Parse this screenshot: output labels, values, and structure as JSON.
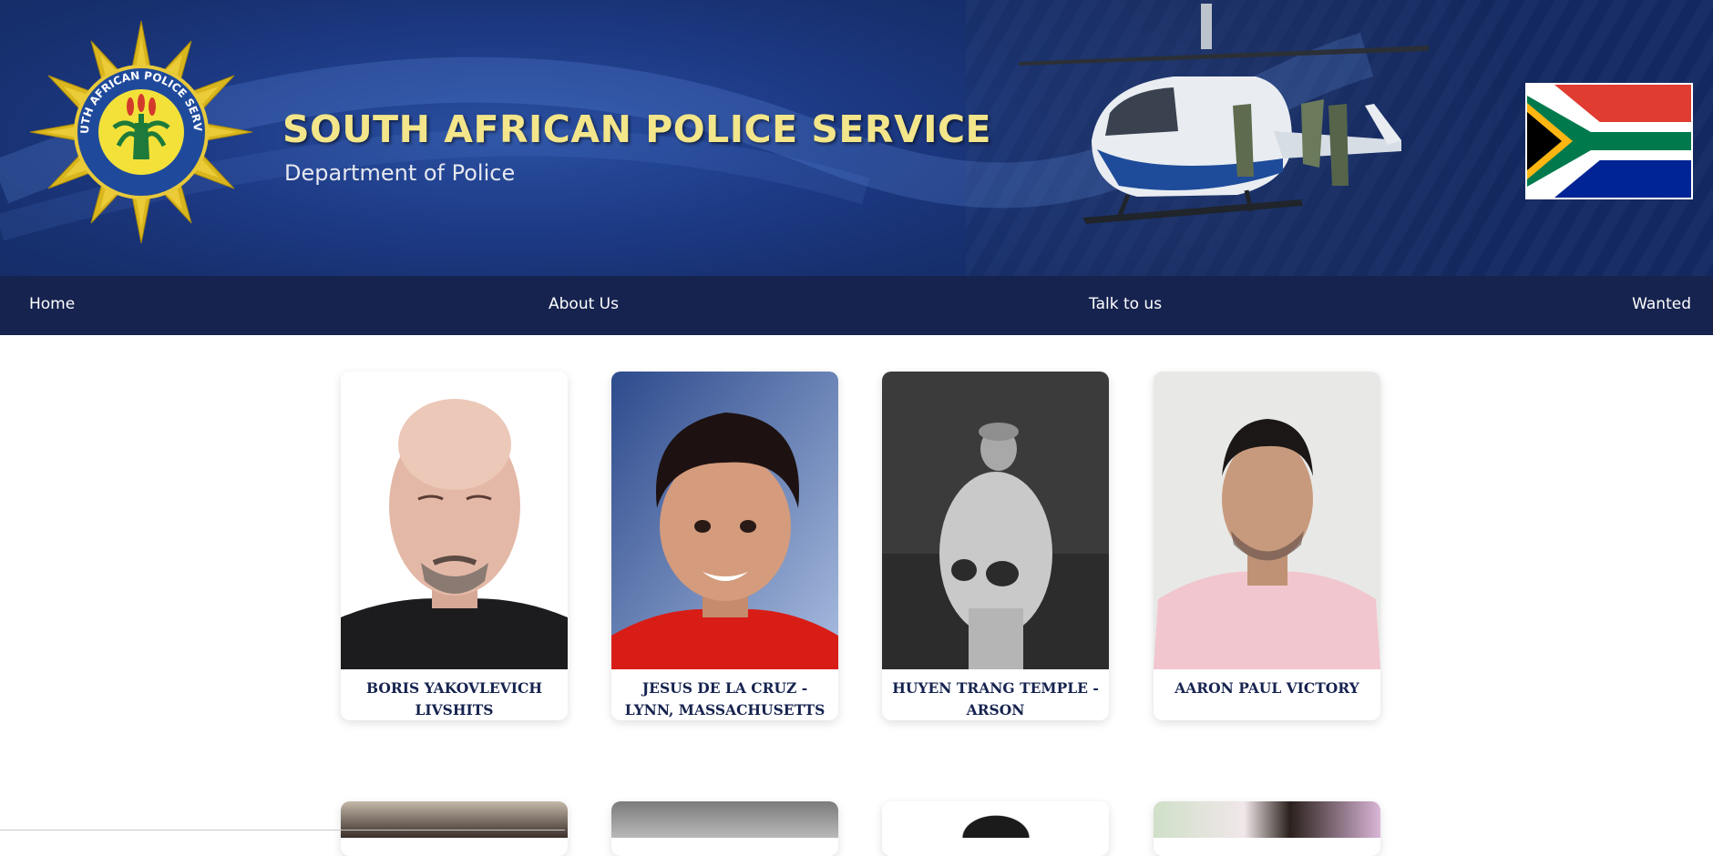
{
  "header": {
    "title": "SOUTH AFRICAN POLICE SERVICE",
    "subtitle": "Department of Police",
    "badge_text": "SOUTH AFRICAN POLICE SERVICE"
  },
  "nav": {
    "items": [
      {
        "label": "Home"
      },
      {
        "label": "About Us"
      },
      {
        "label": "Talk to us"
      },
      {
        "label": "Wanted"
      }
    ]
  },
  "wanted": [
    {
      "name": "BORIS YAKOVLEVICH LIVSHITS"
    },
    {
      "name": "JESUS DE LA CRUZ - LYNN, MASSACHUSETTS"
    },
    {
      "name": "HUYEN TRANG TEMPLE - ARSON"
    },
    {
      "name": "AARON PAUL VICTORY"
    }
  ],
  "colors": {
    "nav_bg": "#16234f",
    "title_gold": "#f3e58a",
    "banner_blue": "#1d3a85",
    "card_text": "#16234f"
  }
}
